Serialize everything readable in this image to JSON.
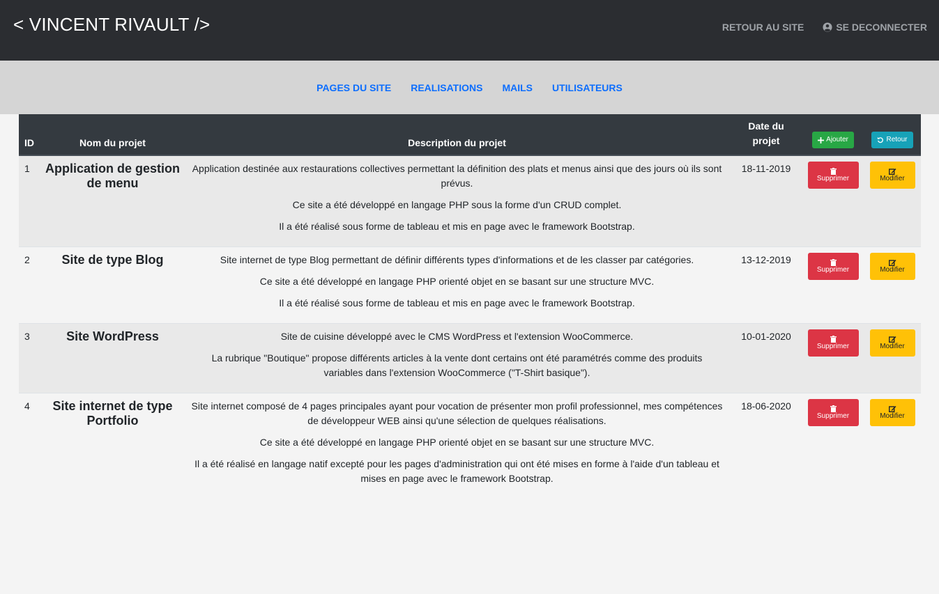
{
  "header": {
    "brand": "< VINCENT RIVAULT />",
    "back_to_site": "RETOUR AU SITE",
    "logout": "SE DECONNECTER"
  },
  "subnav": {
    "items": [
      "PAGES DU SITE",
      "REALISATIONS",
      "MAILS",
      "UTILISATEURS"
    ]
  },
  "table": {
    "headers": {
      "id": "ID",
      "name": "Nom du projet",
      "description": "Description du projet",
      "date_line1": "Date du",
      "date_line2": "projet",
      "add_button": "Ajouter",
      "back_button": "Retour"
    },
    "rows": [
      {
        "id": "1",
        "name": "Application de gestion de menu",
        "description": [
          "Application destinée aux restaurations collectives permettant la définition des plats et menus ainsi que des jours où ils sont prévus.",
          "Ce site a été développé en langage PHP sous la forme d'un CRUD complet.",
          "Il a été réalisé sous forme de tableau et mis en page avec le framework Bootstrap."
        ],
        "date": "18-11-2019",
        "delete_label": "Supprimer",
        "edit_label": "Modifier"
      },
      {
        "id": "2",
        "name": "Site de type Blog",
        "description": [
          "Site internet de type Blog permettant de définir différents types d'informations et de les classer par catégories.",
          "Ce site a été développé en langage PHP orienté objet en se basant sur une structure MVC.",
          "Il a été réalisé sous forme de tableau et mis en page avec le framework Bootstrap."
        ],
        "date": "13-12-2019",
        "delete_label": "Supprimer",
        "edit_label": "Modifier"
      },
      {
        "id": "3",
        "name": "Site WordPress",
        "description": [
          "Site de cuisine développé avec le CMS WordPress et l'extension WooCommerce.",
          "La rubrique \"Boutique\" propose différents articles à la vente dont certains ont été paramétrés comme des produits variables dans l'extension WooCommerce (\"T-Shirt basique\")."
        ],
        "date": "10-01-2020",
        "delete_label": "Supprimer",
        "edit_label": "Modifier"
      },
      {
        "id": "4",
        "name": "Site internet de type Portfolio",
        "description": [
          "Site internet composé de 4 pages principales ayant pour vocation de présenter mon profil professionnel, mes compétences de développeur WEB ainsi qu'une sélection de quelques réalisations.",
          "Ce site a été développé en langage PHP orienté objet en se basant sur une structure MVC.",
          "Il a été réalisé en langage natif excepté pour les pages d'administration qui ont été mises en forme à l'aide d'un tableau et mises en page avec le framework Bootstrap."
        ],
        "date": "18-06-2020",
        "delete_label": "Supprimer",
        "edit_label": "Modifier"
      }
    ]
  },
  "icons": {
    "user": "user-circle-icon",
    "add": "plus-icon",
    "back": "undo-icon",
    "delete": "trash-icon",
    "edit": "edit-icon"
  },
  "colors": {
    "topbar": "#2b2d31",
    "subnav": "#d5d5d5",
    "link": "#0d6efd",
    "danger": "#dc3545",
    "warning": "#ffc107",
    "success": "#28a745",
    "info": "#17a2b8"
  }
}
